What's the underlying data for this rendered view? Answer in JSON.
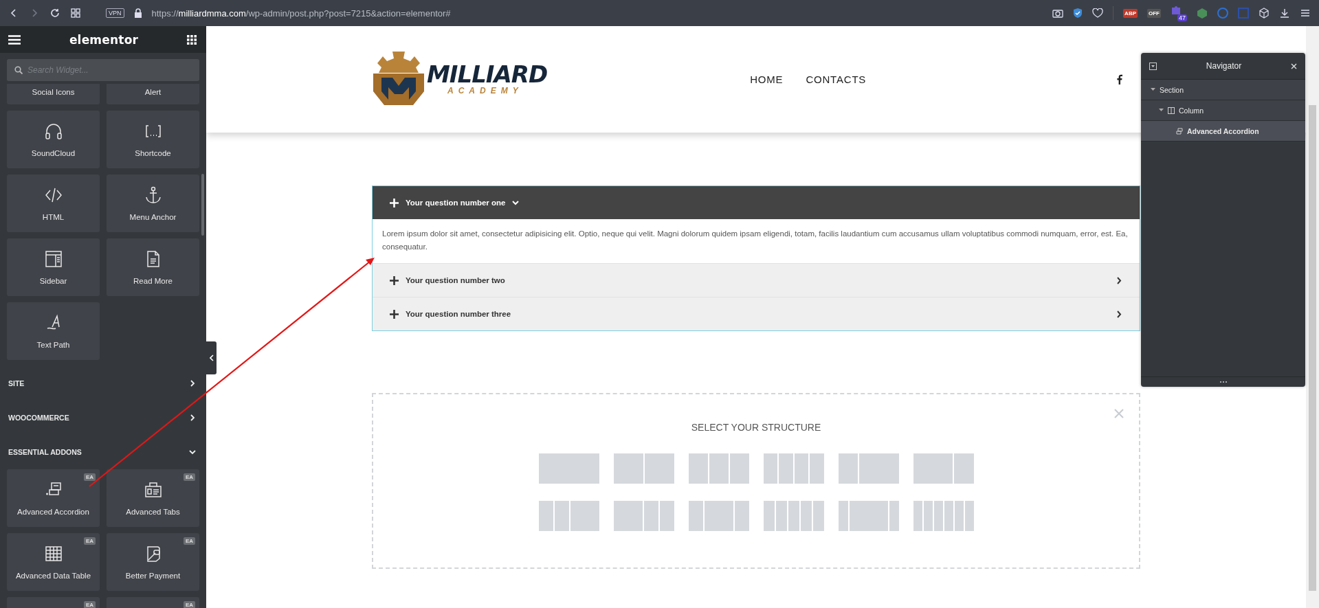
{
  "browser": {
    "vpn": "VPN",
    "url": "https://**milliardmma.com**/wp-admin/post.php?post=7215&action=elementor#",
    "extensions": [
      {
        "kind": "text",
        "label": "ABP",
        "color": "#c0392b"
      },
      {
        "kind": "text",
        "label": "OFF",
        "color": "#555555"
      },
      {
        "kind": "badge",
        "label": "47",
        "color": "#5b3fd1"
      },
      {
        "kind": "cube",
        "color": "#4a8f5a"
      },
      {
        "kind": "circle",
        "color": "#2c6fd6"
      },
      {
        "kind": "square",
        "color": "#2c4fa8"
      }
    ]
  },
  "sidebar": {
    "logo": "elementor",
    "search": {
      "placeholder": "Search Widget..."
    },
    "partial_widgets": [
      "Social Icons",
      "Alert"
    ],
    "widgets": [
      {
        "label": "SoundCloud",
        "kind": "headphones"
      },
      {
        "label": "Shortcode",
        "kind": "brackets"
      },
      {
        "label": "HTML",
        "kind": "code"
      },
      {
        "label": "Menu Anchor",
        "kind": "anchor"
      },
      {
        "label": "Sidebar",
        "kind": "sidebar"
      },
      {
        "label": "Read More",
        "kind": "document"
      },
      {
        "label": "Text Path",
        "kind": "textpath"
      }
    ],
    "categories": [
      {
        "label": "SITE",
        "expanded": false
      },
      {
        "label": "WOOCOMMERCE",
        "expanded": false
      },
      {
        "label": "ESSENTIAL ADDONS",
        "expanded": true
      }
    ],
    "addon_widgets": [
      {
        "label": "Advanced Accordion",
        "kind": "accordion",
        "badge": "EA"
      },
      {
        "label": "Advanced Tabs",
        "kind": "tabs",
        "badge": "EA"
      },
      {
        "label": "Advanced Data Table",
        "kind": "table",
        "badge": "EA"
      },
      {
        "label": "Better Payment",
        "kind": "payment",
        "badge": "EA"
      },
      {
        "kind": "generic",
        "badge": "EA"
      },
      {
        "kind": "generic",
        "badge": "EA"
      }
    ]
  },
  "header": {
    "logo": {
      "title": "MILLIARD",
      "subtitle": "ACADEMY"
    },
    "nav": [
      "HOME",
      "CONTACTS"
    ]
  },
  "accordion": [
    {
      "title": "Your question number one",
      "expanded": true,
      "body": "Lorem ipsum dolor sit amet, consectetur adipisicing elit. Optio, neque qui velit. Magni dolorum quidem ipsam eligendi, totam, facilis laudantium cum accusamus ullam voluptatibus commodi numquam, error, est. Ea, consequatur."
    },
    {
      "title": "Your question number two",
      "expanded": false
    },
    {
      "title": "Your question number three",
      "expanded": false
    }
  ],
  "structure": {
    "title": "SELECT YOUR STRUCTURE"
  },
  "navigator": {
    "title": "Navigator",
    "tree": [
      {
        "label": "Section",
        "expanded": true,
        "selected": false,
        "children": [
          {
            "label": "Column",
            "kind": "column",
            "expanded": true,
            "selected": false,
            "children": [
              {
                "label": "Advanced Accordion",
                "kind": "widget",
                "selected": true
              }
            ]
          }
        ]
      }
    ]
  }
}
